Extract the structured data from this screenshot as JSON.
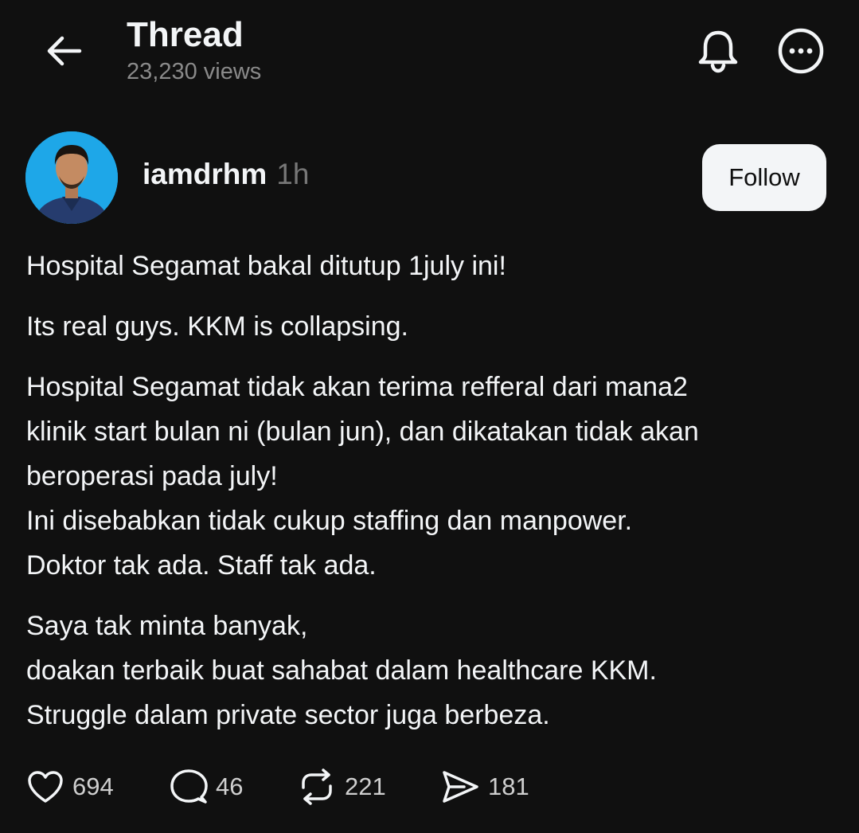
{
  "header": {
    "title": "Thread",
    "views": "23,230 views"
  },
  "post": {
    "username": "iamdrhm",
    "timestamp": "1h",
    "follow_label": "Follow",
    "paragraphs": [
      [
        "Hospital Segamat bakal ditutup 1july ini!"
      ],
      [
        "Its real guys. KKM is collapsing."
      ],
      [
        "Hospital Segamat tidak akan terima refferal dari mana2",
        "klinik start bulan ni (bulan jun), dan dikatakan tidak akan",
        "beroperasi pada july!",
        "Ini disebabkan tidak cukup staffing dan manpower.",
        "Doktor tak ada. Staff tak ada."
      ],
      [
        "Saya tak minta banyak,",
        "doakan terbaik buat sahabat dalam healthcare KKM.",
        "Struggle dalam private sector juga berbeza."
      ]
    ]
  },
  "actions": {
    "likes": "694",
    "replies": "46",
    "reposts": "221",
    "shares": "181"
  },
  "icons": {
    "back": "back-arrow-icon",
    "notifications": "bell-icon",
    "more": "more-options-icon",
    "like": "heart-icon",
    "reply": "comment-icon",
    "repost": "repost-icon",
    "share": "share-icon"
  },
  "colors": {
    "background": "#101010",
    "text": "#f3f5f7",
    "muted": "#8a8a8a",
    "avatar_bg": "#1ea7e8"
  }
}
